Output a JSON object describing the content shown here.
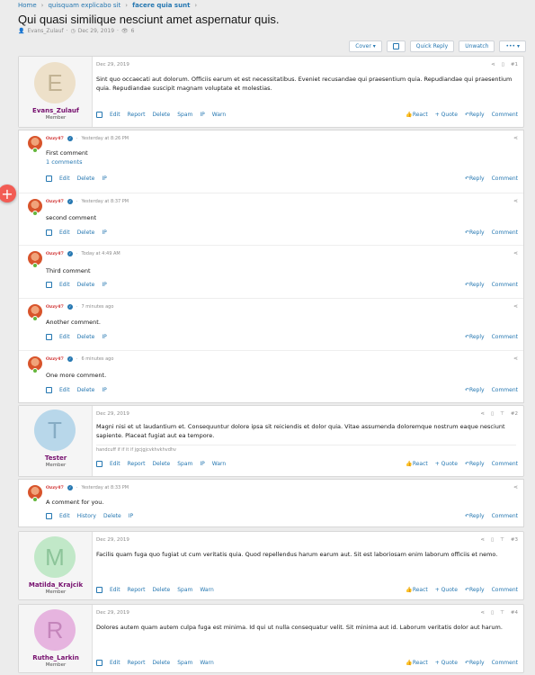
{
  "breadcrumb": {
    "home": "Home",
    "forum": "quisquam explicabo sit",
    "current": "facere quia sunt"
  },
  "thread": {
    "title": "Qui quasi similique nesciunt amet aspernatur quis.",
    "author": "Evans_Zulauf",
    "date": "Dec 29, 2019",
    "views": "6"
  },
  "toolbar": {
    "cover": "Cover",
    "quick_reply": "Quick Reply",
    "unwatch": "Unwatch",
    "more": "•••"
  },
  "actions": {
    "edit": "Edit",
    "report": "Report",
    "delete": "Delete",
    "spam": "Spam",
    "ip": "IP",
    "warn": "Warn",
    "history": "History",
    "react": "React",
    "quote": "+ Quote",
    "reply": "Reply",
    "comment": "Comment"
  },
  "posts": [
    {
      "author": "Evans_Zulauf",
      "role": "Member",
      "initial": "E",
      "avatar_bg": "#ede0c9",
      "avatar_fg": "#c2b394",
      "date": "Dec 29, 2019",
      "num": "#1",
      "text": "Sint quo occaecati aut dolorum. Officiis earum et est necessitatibus. Eveniet recusandae qui praesentium quia. Repudiandae qui praesentium quia. Repudiandae suscipit magnam voluptate et molestias."
    },
    {
      "author": "Tester",
      "role": "Member",
      "initial": "T",
      "avatar_bg": "#b8d7ea",
      "avatar_fg": "#86acc4",
      "date": "Dec 29, 2019",
      "num": "#2",
      "text": "Magni nisi et ut laudantium et. Consequuntur dolore ipsa sit reiciendis et dolor quia. Vitae assumenda doloremque nostrum eaque nesciunt sapiente. Placeat fugiat aut ea tempore.",
      "signature": "handcuff if if it if jgcjgjcvkhvkhvdhv"
    },
    {
      "author": "Matilda_Krajcik",
      "role": "Member",
      "initial": "M",
      "avatar_bg": "#c1e8c8",
      "avatar_fg": "#8cc499",
      "date": "Dec 29, 2019",
      "num": "#3",
      "text": "Facilis quam fuga quo fugiat ut cum veritatis quia. Quod repellendus harum earum aut. Sit est laboriosam enim laborum officiis et nemo."
    },
    {
      "author": "Ruthe_Larkin",
      "role": "Member",
      "initial": "R",
      "avatar_bg": "#e6b4df",
      "avatar_fg": "#c485bb",
      "date": "Dec 29, 2019",
      "num": "#4",
      "text": "Dolores autem quam autem culpa fuga est minima. Id qui ut nulla consequatur velit. Sit minima aut id. Laborum veritatis dolor aut harum."
    }
  ],
  "comments": [
    {
      "author": "Ozzy47",
      "time": "Yesterday at 8:26 PM",
      "text": "First comment",
      "link": "1 comments"
    },
    {
      "author": "Ozzy47",
      "time": "Yesterday at 8:37 PM",
      "text": "second comment"
    },
    {
      "author": "Ozzy47",
      "time": "Today at 4:49 AM",
      "text": "Third comment"
    },
    {
      "author": "Ozzy47",
      "time": "7 minutes ago",
      "text": "Another comment."
    },
    {
      "author": "Ozzy47",
      "time": "6 minutes ago",
      "text": "One more comment."
    },
    {
      "author": "Ozzy47",
      "time": "Yesterday at 8:33 PM",
      "text": "A comment for you."
    }
  ]
}
